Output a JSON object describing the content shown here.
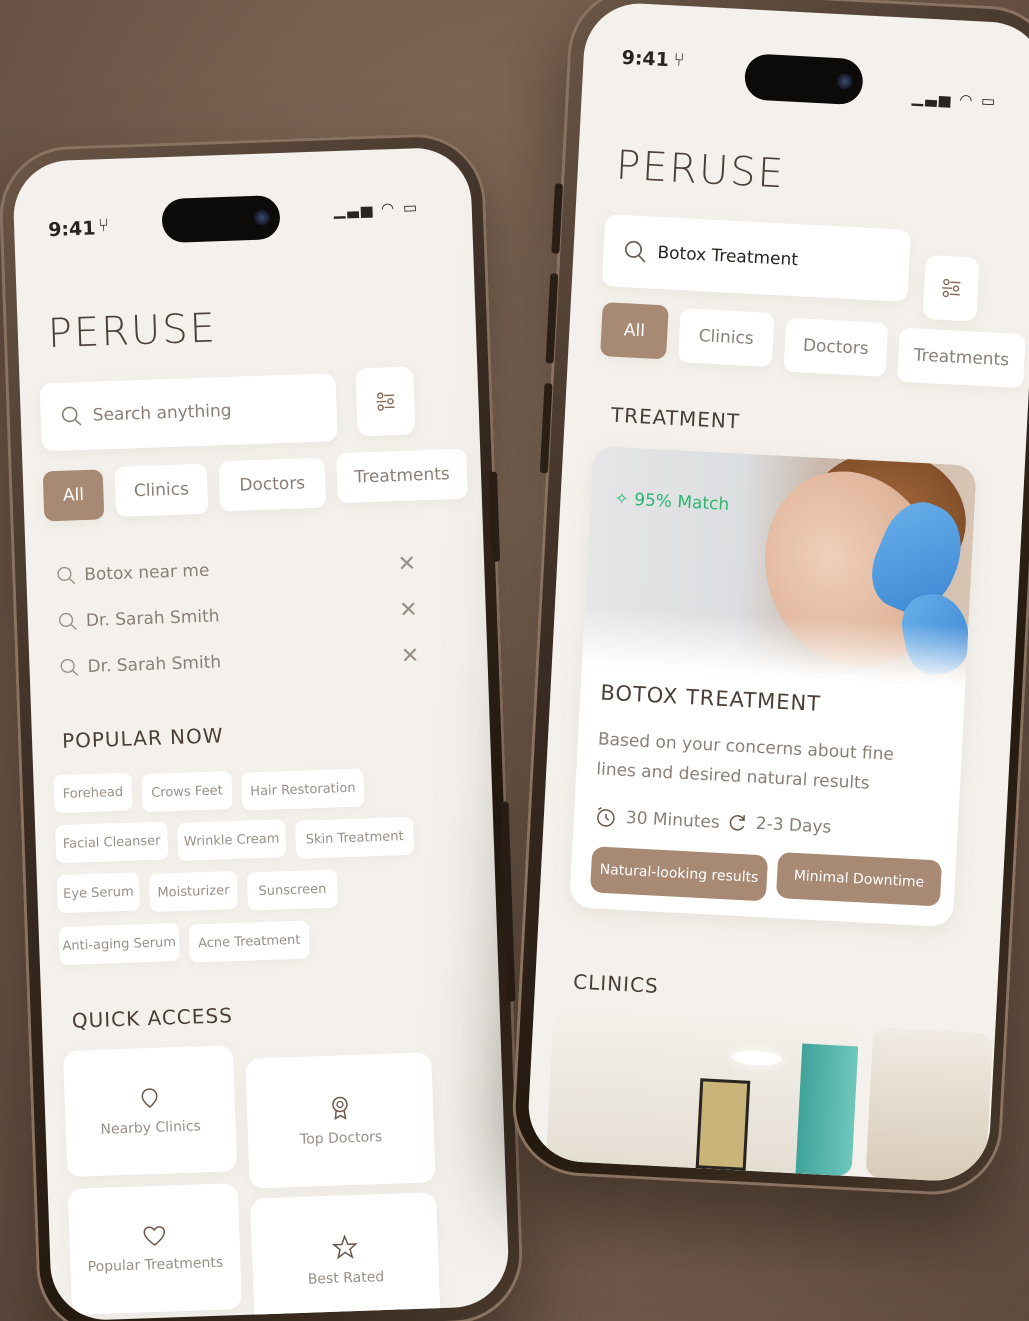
{
  "colors": {
    "accent": "#a88a74",
    "match": "#2bb673",
    "screen_bg": "#f4f1ec",
    "background": "#765f4f"
  },
  "phone_left": {
    "status_time": "9:41",
    "brand": "PERUSE",
    "search": {
      "placeholder": "Search anything",
      "icon": "search-icon"
    },
    "filter_icon": "sliders-icon",
    "tabs": [
      {
        "label": "All",
        "active": true
      },
      {
        "label": "Clinics",
        "active": false
      },
      {
        "label": "Doctors",
        "active": false
      },
      {
        "label": "Treatments",
        "active": false
      }
    ],
    "recent_searches": [
      {
        "text": "Botox near me"
      },
      {
        "text": "Dr. Sarah Smith"
      },
      {
        "text": "Dr. Sarah Smith"
      }
    ],
    "popular_title": "POPULAR NOW",
    "popular_tags": [
      "Forehead",
      "Crows Feet",
      "Hair Restoration",
      "Facial Cleanser",
      "Wrinkle Cream",
      "Skin Treatment",
      "Eye Serum",
      "Moisturizer",
      "Sunscreen",
      "Anti-aging Serum",
      "Acne Treatment"
    ],
    "quick_access_title": "QUICK ACCESS",
    "quick_access": [
      {
        "label": "Nearby Clinics",
        "icon": "location-pin-icon"
      },
      {
        "label": "Top Doctors",
        "icon": "award-icon"
      },
      {
        "label": "Popular Treatments",
        "icon": "heart-icon"
      },
      {
        "label": "Best Rated",
        "icon": "star-icon"
      }
    ]
  },
  "phone_right": {
    "status_time": "9:41",
    "brand": "PERUSE",
    "search": {
      "value": "Botox Treatment",
      "icon": "search-icon"
    },
    "filter_icon": "sliders-icon",
    "tabs": [
      {
        "label": "All",
        "active": true
      },
      {
        "label": "Clinics",
        "active": false
      },
      {
        "label": "Doctors",
        "active": false
      },
      {
        "label": "Treatments",
        "active": false
      }
    ],
    "treatment_section_title": "TREATMENT",
    "treatment_card": {
      "match": "95% Match",
      "title": "BOTOX TREATMENT",
      "description": "Based on your concerns about fine lines and desired natural results",
      "duration": "30 Minutes",
      "downtime_days": "2-3 Days",
      "pills": [
        "Natural-looking results",
        "Minimal Downtime"
      ]
    },
    "clinics_section_title": "CLINICS"
  }
}
